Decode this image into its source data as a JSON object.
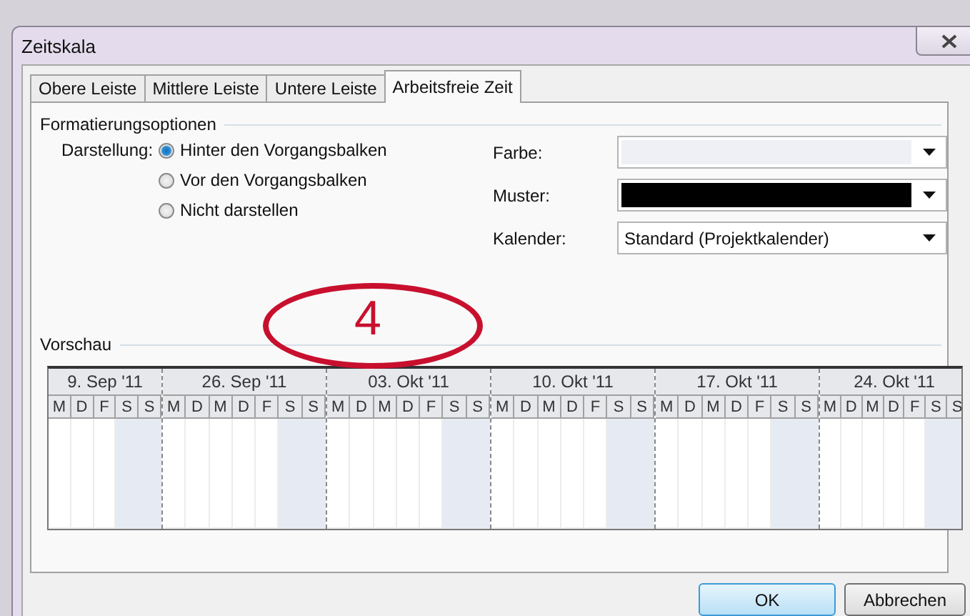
{
  "window": {
    "title": "Zeitskala"
  },
  "tabs": [
    {
      "label": "Obere Leiste",
      "selected": false
    },
    {
      "label": "Mittlere Leiste",
      "selected": false
    },
    {
      "label": "Untere Leiste",
      "selected": false
    },
    {
      "label": "Arbeitsfreie Zeit",
      "selected": true
    }
  ],
  "formatting": {
    "heading": "Formatierungsoptionen",
    "display_label": "Darstellung:",
    "options": [
      {
        "label": "Hinter den Vorgangsbalken",
        "selected": true
      },
      {
        "label": "Vor den Vorgangsbalken",
        "selected": false
      },
      {
        "label": "Nicht darstellen",
        "selected": false
      }
    ],
    "fields": [
      {
        "label": "Farbe:",
        "kind": "color",
        "color": "#eef0f5"
      },
      {
        "label": "Muster:",
        "kind": "color",
        "color": "#000000"
      },
      {
        "label": "Kalender:",
        "kind": "text",
        "value": "Standard (Projektkalender)"
      }
    ]
  },
  "annotation": {
    "text": "4"
  },
  "preview": {
    "heading": "Vorschau",
    "weeks": [
      {
        "label": "9. Sep '11",
        "days": [
          {
            "label": "M",
            "nonworking": false
          },
          {
            "label": "D",
            "nonworking": false
          },
          {
            "label": "F",
            "nonworking": false
          },
          {
            "label": "S",
            "nonworking": true
          },
          {
            "label": "S",
            "nonworking": true
          }
        ]
      },
      {
        "label": "26. Sep '11",
        "days": [
          {
            "label": "M",
            "nonworking": false
          },
          {
            "label": "D",
            "nonworking": false
          },
          {
            "label": "M",
            "nonworking": false
          },
          {
            "label": "D",
            "nonworking": false
          },
          {
            "label": "F",
            "nonworking": false
          },
          {
            "label": "S",
            "nonworking": true
          },
          {
            "label": "S",
            "nonworking": true
          }
        ]
      },
      {
        "label": "03. Okt '11",
        "days": [
          {
            "label": "M",
            "nonworking": false
          },
          {
            "label": "D",
            "nonworking": false
          },
          {
            "label": "M",
            "nonworking": false
          },
          {
            "label": "D",
            "nonworking": false
          },
          {
            "label": "F",
            "nonworking": false
          },
          {
            "label": "S",
            "nonworking": true
          },
          {
            "label": "S",
            "nonworking": true
          }
        ]
      },
      {
        "label": "10. Okt '11",
        "days": [
          {
            "label": "M",
            "nonworking": false
          },
          {
            "label": "D",
            "nonworking": false
          },
          {
            "label": "M",
            "nonworking": false
          },
          {
            "label": "D",
            "nonworking": false
          },
          {
            "label": "F",
            "nonworking": false
          },
          {
            "label": "S",
            "nonworking": true
          },
          {
            "label": "S",
            "nonworking": true
          }
        ]
      },
      {
        "label": "17. Okt '11",
        "days": [
          {
            "label": "M",
            "nonworking": false
          },
          {
            "label": "D",
            "nonworking": false
          },
          {
            "label": "M",
            "nonworking": false
          },
          {
            "label": "D",
            "nonworking": false
          },
          {
            "label": "F",
            "nonworking": false
          },
          {
            "label": "S",
            "nonworking": true
          },
          {
            "label": "S",
            "nonworking": true
          }
        ]
      },
      {
        "label": "24. Okt '11",
        "days": [
          {
            "label": "M",
            "nonworking": false
          },
          {
            "label": "D",
            "nonworking": false
          },
          {
            "label": "M",
            "nonworking": false
          },
          {
            "label": "D",
            "nonworking": false
          },
          {
            "label": "F",
            "nonworking": false
          },
          {
            "label": "S",
            "nonworking": true
          },
          {
            "label": "S",
            "nonworking": true
          }
        ]
      }
    ]
  },
  "buttons": [
    {
      "label": "OK",
      "default": true
    },
    {
      "label": "Abbrechen",
      "default": false
    }
  ]
}
